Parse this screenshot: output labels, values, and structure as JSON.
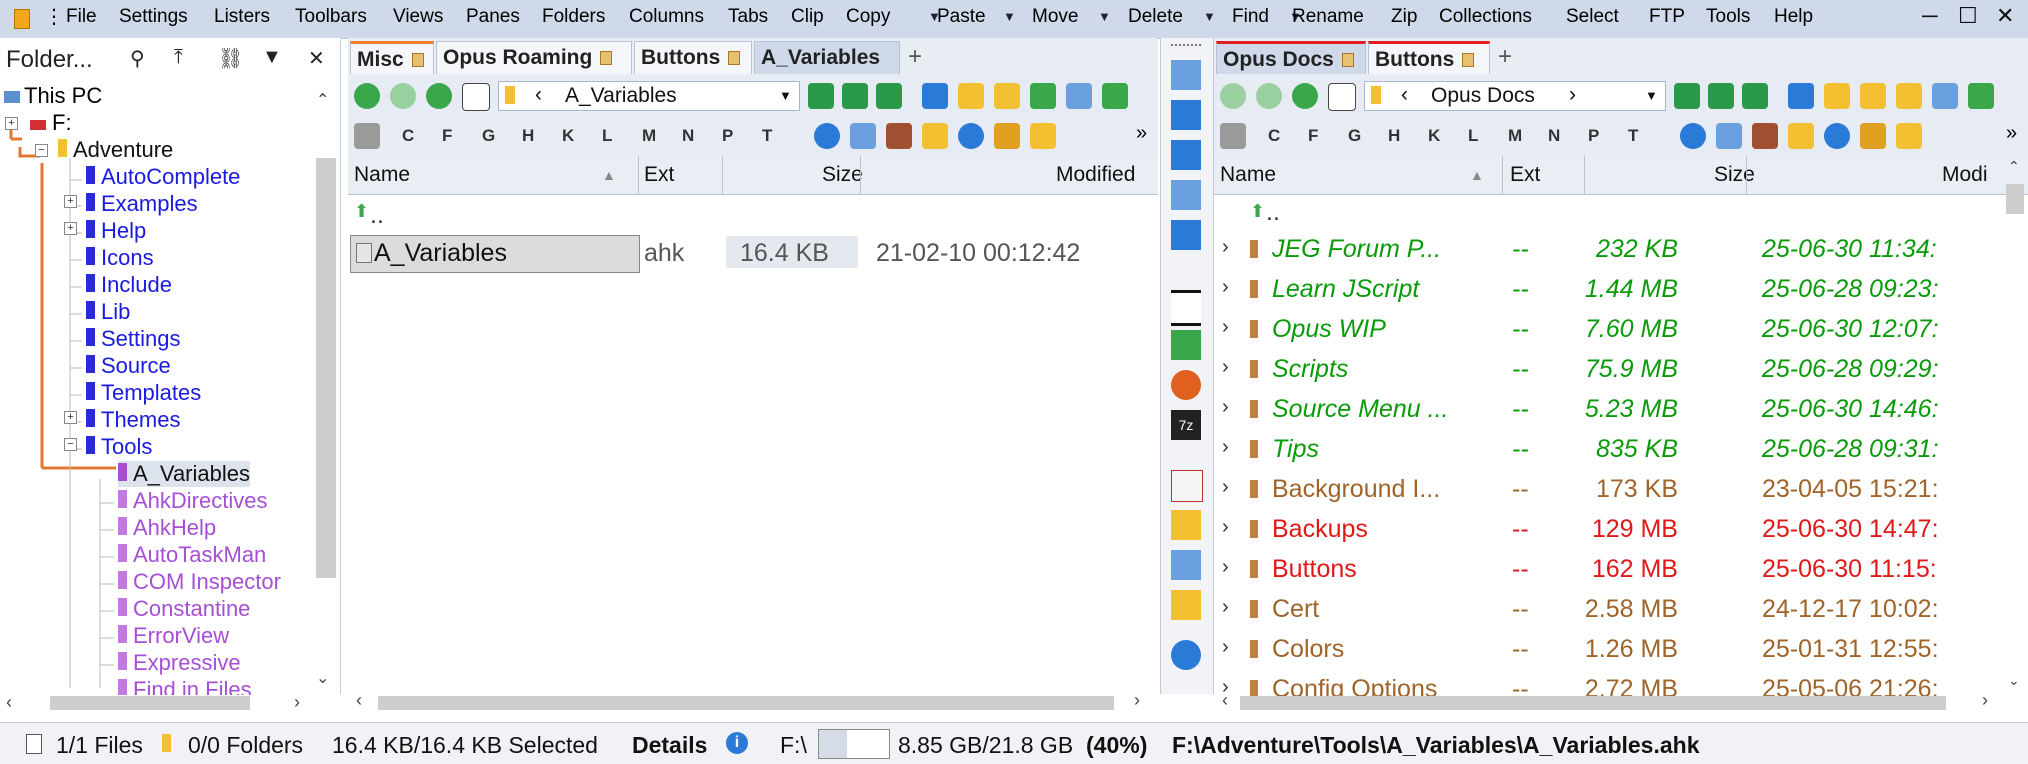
{
  "menubar": {
    "items": [
      "File",
      "Settings",
      "Listers",
      "Toolbars",
      "Views",
      "Panes",
      "Folders",
      "Columns",
      "Tabs",
      "Clip",
      "Copy",
      "Paste",
      "Move",
      "Delete",
      "Find",
      "Rename",
      "Zip",
      "Collections",
      "Select",
      "FTP",
      "Tools",
      "Help"
    ]
  },
  "tree": {
    "header": "Folder...",
    "root": "This PC",
    "drive": "F:",
    "folder": "Adventure",
    "children": [
      "AutoComplete",
      "Examples",
      "Help",
      "Icons",
      "Include",
      "Lib",
      "Settings",
      "Source",
      "Templates",
      "Themes",
      "Tools"
    ],
    "tools_children": [
      "A_Variables",
      "AhkDirectives",
      "AhkHelp",
      "AutoTaskMan",
      "COM Inspector",
      "Constantine",
      "ErrorView",
      "Expressive",
      "Find in Files"
    ]
  },
  "left_pane": {
    "tabs": [
      "Misc",
      "Opus Roaming",
      "Buttons",
      "A_Variables"
    ],
    "path": "A_Variables",
    "drives": [
      "C",
      "F",
      "G",
      "H",
      "K",
      "L",
      "M",
      "N",
      "P",
      "T"
    ],
    "columns": {
      "name": "Name",
      "ext": "Ext",
      "size": "Size",
      "modified": "Modified"
    },
    "parent": "..",
    "file": {
      "name": "A_Variables",
      "ext": "ahk",
      "size": "16.4 KB",
      "modified": "21-02-10  00:12:42"
    }
  },
  "right_pane": {
    "tabs": [
      "Opus Docs",
      "Buttons"
    ],
    "path": "Opus Docs",
    "drives": [
      "C",
      "F",
      "G",
      "H",
      "K",
      "L",
      "M",
      "N",
      "P",
      "T"
    ],
    "columns": {
      "name": "Name",
      "ext": "Ext",
      "size": "Size",
      "modified": "Modi"
    },
    "parent": "..",
    "rows": [
      {
        "name": "JEG Forum P...",
        "ext": "--",
        "size": "232 KB",
        "modified": "25-06-30  11:34:",
        "color": "#0a9a0a",
        "italic": true
      },
      {
        "name": "Learn JScript",
        "ext": "--",
        "size": "1.44 MB",
        "modified": "25-06-28  09:23:",
        "color": "#0a9a0a",
        "italic": true
      },
      {
        "name": "Opus WIP",
        "ext": "--",
        "size": "7.60 MB",
        "modified": "25-06-30  12:07:",
        "color": "#0a9a0a",
        "italic": true
      },
      {
        "name": "Scripts",
        "ext": "--",
        "size": "75.9 MB",
        "modified": "25-06-28  09:29:",
        "color": "#0a9a0a",
        "italic": true
      },
      {
        "name": "Source Menu ...",
        "ext": "--",
        "size": "5.23 MB",
        "modified": "25-06-30  14:46:",
        "color": "#0a9a0a",
        "italic": true
      },
      {
        "name": "Tips",
        "ext": "--",
        "size": "835 KB",
        "modified": "25-06-28  09:31:",
        "color": "#0a9a0a",
        "italic": true
      },
      {
        "name": "Background I...",
        "ext": "--",
        "size": "173 KB",
        "modified": "23-04-05  15:21:",
        "color": "#a0642a",
        "italic": false
      },
      {
        "name": "Backups",
        "ext": "--",
        "size": "129 MB",
        "modified": "25-06-30  14:47:",
        "color": "#e01818",
        "italic": false
      },
      {
        "name": "Buttons",
        "ext": "--",
        "size": "162 MB",
        "modified": "25-06-30  11:15:",
        "color": "#e01818",
        "italic": false
      },
      {
        "name": "Cert",
        "ext": "--",
        "size": "2.58 MB",
        "modified": "24-12-17  10:02:",
        "color": "#a0642a",
        "italic": false
      },
      {
        "name": "Colors",
        "ext": "--",
        "size": "1.26 MB",
        "modified": "25-01-31  12:55:",
        "color": "#a0642a",
        "italic": false
      },
      {
        "name": "Config Options",
        "ext": "--",
        "size": "2.72 MB",
        "modified": "25-05-06  21:26:",
        "color": "#a0642a",
        "italic": false
      }
    ]
  },
  "status": {
    "files": "1/1 Files",
    "folders": "0/0 Folders",
    "selected": "16.4 KB/16.4 KB Selected",
    "details": "Details",
    "drive": "F:\\",
    "space": "8.85 GB/21.8 GB",
    "percent": "(40%)",
    "path": "F:\\Adventure\\Tools\\A_Variables\\A_Variables.ahk"
  },
  "colors": {
    "accent": "#cfd9ea",
    "tree_blue": "#1a1ae0",
    "tree_purple": "#a64fd6",
    "tree_line": "#e07a30"
  }
}
